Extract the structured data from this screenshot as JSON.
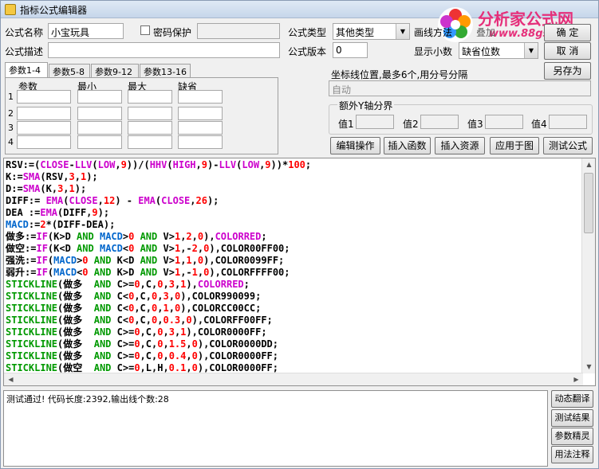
{
  "window": {
    "title": "指标公式编辑器"
  },
  "form": {
    "name_label": "公式名称",
    "name_value": "小宝玩具",
    "password_label": "密码保护",
    "type_label": "公式类型",
    "type_value": "其他类型",
    "draw_method_label": "画线方法",
    "desc_label": "公式描述",
    "desc_value": "",
    "version_label": "公式版本",
    "version_value": "0",
    "decimals_label": "显示小数",
    "decimals_value": "缺省位数",
    "ok_label": "确 定",
    "cancel_label": "取 消",
    "saveas_label": "另存为",
    "overlay_partial": "叠加"
  },
  "tabs": [
    "参数1-4",
    "参数5-8",
    "参数9-12",
    "参数13-16"
  ],
  "params": {
    "headers": [
      "参数",
      "最小",
      "最大",
      "缺省"
    ],
    "rows": [
      "1",
      "2",
      "3",
      "4"
    ]
  },
  "axis": {
    "label": "坐标线位置,最多6个,用分号分隔",
    "value": "自动",
    "group_title": "额外Y轴分界",
    "value_labels": [
      "值1",
      "值2",
      "值3",
      "值4"
    ]
  },
  "actions": [
    "编辑操作",
    "插入函数",
    "插入资源",
    "应用于图",
    "测试公式"
  ],
  "side_buttons": [
    "动态翻译",
    "测试结果",
    "参数精灵",
    "用法注释"
  ],
  "output_text": "测试通过! 代码长度:2392,输出线个数:28",
  "watermark": {
    "title": "分析家公式网",
    "url": "www.88gs.com"
  },
  "colors": {
    "keyword": "#009900",
    "function": "#cc00cc",
    "number": "#ff0000",
    "macd": "#0066cc",
    "title_bg": "#c6d6ea"
  },
  "code_lines": [
    [
      {
        "t": "RSV:=(",
        "c": "#000"
      },
      {
        "t": "CLOSE",
        "c": "#c0c"
      },
      {
        "t": "-",
        "c": "#000"
      },
      {
        "t": "LLV",
        "c": "#c0c"
      },
      {
        "t": "(",
        "c": "#000"
      },
      {
        "t": "LOW",
        "c": "#c0c"
      },
      {
        "t": ",",
        "c": "#000"
      },
      {
        "t": "9",
        "c": "#f00"
      },
      {
        "t": "))/(",
        "c": "#000"
      },
      {
        "t": "HHV",
        "c": "#c0c"
      },
      {
        "t": "(",
        "c": "#000"
      },
      {
        "t": "HIGH",
        "c": "#c0c"
      },
      {
        "t": ",",
        "c": "#000"
      },
      {
        "t": "9",
        "c": "#f00"
      },
      {
        "t": ")-",
        "c": "#000"
      },
      {
        "t": "LLV",
        "c": "#c0c"
      },
      {
        "t": "(",
        "c": "#000"
      },
      {
        "t": "LOW",
        "c": "#c0c"
      },
      {
        "t": ",",
        "c": "#000"
      },
      {
        "t": "9",
        "c": "#f00"
      },
      {
        "t": "))*",
        "c": "#000"
      },
      {
        "t": "100",
        "c": "#f00"
      },
      {
        "t": ";",
        "c": "#000"
      }
    ],
    [
      {
        "t": "K:=",
        "c": "#000"
      },
      {
        "t": "SMA",
        "c": "#c0c"
      },
      {
        "t": "(RSV,",
        "c": "#000"
      },
      {
        "t": "3",
        "c": "#f00"
      },
      {
        "t": ",",
        "c": "#000"
      },
      {
        "t": "1",
        "c": "#f00"
      },
      {
        "t": ");",
        "c": "#000"
      }
    ],
    [
      {
        "t": "D:=",
        "c": "#000"
      },
      {
        "t": "SMA",
        "c": "#c0c"
      },
      {
        "t": "(K,",
        "c": "#000"
      },
      {
        "t": "3",
        "c": "#f00"
      },
      {
        "t": ",",
        "c": "#000"
      },
      {
        "t": "1",
        "c": "#f00"
      },
      {
        "t": ");",
        "c": "#000"
      }
    ],
    [
      {
        "t": "DIFF:= ",
        "c": "#000"
      },
      {
        "t": "EMA",
        "c": "#c0c"
      },
      {
        "t": "(",
        "c": "#000"
      },
      {
        "t": "CLOSE",
        "c": "#c0c"
      },
      {
        "t": ",",
        "c": "#000"
      },
      {
        "t": "12",
        "c": "#f00"
      },
      {
        "t": ") - ",
        "c": "#000"
      },
      {
        "t": "EMA",
        "c": "#c0c"
      },
      {
        "t": "(",
        "c": "#000"
      },
      {
        "t": "CLOSE",
        "c": "#c0c"
      },
      {
        "t": ",",
        "c": "#000"
      },
      {
        "t": "26",
        "c": "#f00"
      },
      {
        "t": ");",
        "c": "#000"
      }
    ],
    [
      {
        "t": "DEA :=",
        "c": "#000"
      },
      {
        "t": "EMA",
        "c": "#c0c"
      },
      {
        "t": "(DIFF,",
        "c": "#000"
      },
      {
        "t": "9",
        "c": "#f00"
      },
      {
        "t": ");",
        "c": "#000"
      }
    ],
    [
      {
        "t": "MACD",
        "c": "#06c"
      },
      {
        "t": ":=",
        "c": "#000"
      },
      {
        "t": "2",
        "c": "#f00"
      },
      {
        "t": "*(DIFF-DEA);",
        "c": "#000"
      }
    ],
    [
      {
        "t": "做多",
        "c": "#000"
      },
      {
        "t": ":=",
        "c": "#000"
      },
      {
        "t": "IF",
        "c": "#c0c"
      },
      {
        "t": "(K>D ",
        "c": "#000"
      },
      {
        "t": "AND",
        "c": "#090"
      },
      {
        "t": " ",
        "c": "#000"
      },
      {
        "t": "MACD",
        "c": "#06c"
      },
      {
        "t": ">",
        "c": "#000"
      },
      {
        "t": "0",
        "c": "#f00"
      },
      {
        "t": " ",
        "c": "#000"
      },
      {
        "t": "AND",
        "c": "#090"
      },
      {
        "t": " V>",
        "c": "#000"
      },
      {
        "t": "1",
        "c": "#f00"
      },
      {
        "t": ",",
        "c": "#000"
      },
      {
        "t": "2",
        "c": "#f00"
      },
      {
        "t": ",",
        "c": "#000"
      },
      {
        "t": "0",
        "c": "#f00"
      },
      {
        "t": "),",
        "c": "#000"
      },
      {
        "t": "COLORRED",
        "c": "#c0c"
      },
      {
        "t": ";",
        "c": "#000"
      }
    ],
    [
      {
        "t": "做空",
        "c": "#000"
      },
      {
        "t": ":=",
        "c": "#000"
      },
      {
        "t": "IF",
        "c": "#c0c"
      },
      {
        "t": "(K<D ",
        "c": "#000"
      },
      {
        "t": "AND",
        "c": "#090"
      },
      {
        "t": " ",
        "c": "#000"
      },
      {
        "t": "MACD",
        "c": "#06c"
      },
      {
        "t": "<",
        "c": "#000"
      },
      {
        "t": "0",
        "c": "#f00"
      },
      {
        "t": " ",
        "c": "#000"
      },
      {
        "t": "AND",
        "c": "#090"
      },
      {
        "t": " V>",
        "c": "#000"
      },
      {
        "t": "1",
        "c": "#f00"
      },
      {
        "t": ",-",
        "c": "#000"
      },
      {
        "t": "2",
        "c": "#f00"
      },
      {
        "t": ",",
        "c": "#000"
      },
      {
        "t": "0",
        "c": "#f00"
      },
      {
        "t": "),COLOR00FF00;",
        "c": "#000"
      }
    ],
    [
      {
        "t": "强洗",
        "c": "#000"
      },
      {
        "t": ":=",
        "c": "#000"
      },
      {
        "t": "IF",
        "c": "#c0c"
      },
      {
        "t": "(",
        "c": "#000"
      },
      {
        "t": "MACD",
        "c": "#06c"
      },
      {
        "t": ">",
        "c": "#000"
      },
      {
        "t": "0",
        "c": "#f00"
      },
      {
        "t": " ",
        "c": "#000"
      },
      {
        "t": "AND",
        "c": "#090"
      },
      {
        "t": " K<D ",
        "c": "#000"
      },
      {
        "t": "AND",
        "c": "#090"
      },
      {
        "t": " V>",
        "c": "#000"
      },
      {
        "t": "1",
        "c": "#f00"
      },
      {
        "t": ",",
        "c": "#000"
      },
      {
        "t": "1",
        "c": "#f00"
      },
      {
        "t": ",",
        "c": "#000"
      },
      {
        "t": "0",
        "c": "#f00"
      },
      {
        "t": "),COLOR0099FF;",
        "c": "#000"
      }
    ],
    [
      {
        "t": "弱升",
        "c": "#000"
      },
      {
        "t": ":=",
        "c": "#000"
      },
      {
        "t": "IF",
        "c": "#c0c"
      },
      {
        "t": "(",
        "c": "#000"
      },
      {
        "t": "MACD",
        "c": "#06c"
      },
      {
        "t": "<",
        "c": "#000"
      },
      {
        "t": "0",
        "c": "#f00"
      },
      {
        "t": " ",
        "c": "#000"
      },
      {
        "t": "AND",
        "c": "#090"
      },
      {
        "t": " K>D ",
        "c": "#000"
      },
      {
        "t": "AND",
        "c": "#090"
      },
      {
        "t": " V>",
        "c": "#000"
      },
      {
        "t": "1",
        "c": "#f00"
      },
      {
        "t": ",-",
        "c": "#000"
      },
      {
        "t": "1",
        "c": "#f00"
      },
      {
        "t": ",",
        "c": "#000"
      },
      {
        "t": "0",
        "c": "#f00"
      },
      {
        "t": "),COLORFFFF00;",
        "c": "#000"
      }
    ],
    [
      {
        "t": "STICKLINE",
        "c": "#090"
      },
      {
        "t": "(做多  ",
        "c": "#000"
      },
      {
        "t": "AND",
        "c": "#090"
      },
      {
        "t": " C>=",
        "c": "#000"
      },
      {
        "t": "0",
        "c": "#f00"
      },
      {
        "t": ",C,",
        "c": "#000"
      },
      {
        "t": "0",
        "c": "#f00"
      },
      {
        "t": ",",
        "c": "#000"
      },
      {
        "t": "3",
        "c": "#f00"
      },
      {
        "t": ",",
        "c": "#000"
      },
      {
        "t": "1",
        "c": "#f00"
      },
      {
        "t": "),",
        "c": "#000"
      },
      {
        "t": "COLORRED",
        "c": "#c0c"
      },
      {
        "t": ";",
        "c": "#000"
      }
    ],
    [
      {
        "t": "STICKLINE",
        "c": "#090"
      },
      {
        "t": "(做多  ",
        "c": "#000"
      },
      {
        "t": "AND",
        "c": "#090"
      },
      {
        "t": " C<",
        "c": "#000"
      },
      {
        "t": "0",
        "c": "#f00"
      },
      {
        "t": ",C,",
        "c": "#000"
      },
      {
        "t": "0",
        "c": "#f00"
      },
      {
        "t": ",",
        "c": "#000"
      },
      {
        "t": "3",
        "c": "#f00"
      },
      {
        "t": ",",
        "c": "#000"
      },
      {
        "t": "0",
        "c": "#f00"
      },
      {
        "t": "),COLOR990099;",
        "c": "#000"
      }
    ],
    [
      {
        "t": "STICKLINE",
        "c": "#090"
      },
      {
        "t": "(做多  ",
        "c": "#000"
      },
      {
        "t": "AND",
        "c": "#090"
      },
      {
        "t": " C<",
        "c": "#000"
      },
      {
        "t": "0",
        "c": "#f00"
      },
      {
        "t": ",C,",
        "c": "#000"
      },
      {
        "t": "0",
        "c": "#f00"
      },
      {
        "t": ",",
        "c": "#000"
      },
      {
        "t": "1",
        "c": "#f00"
      },
      {
        "t": ",",
        "c": "#000"
      },
      {
        "t": "0",
        "c": "#f00"
      },
      {
        "t": "),COLORCC00CC;",
        "c": "#000"
      }
    ],
    [
      {
        "t": "STICKLINE",
        "c": "#090"
      },
      {
        "t": "(做多  ",
        "c": "#000"
      },
      {
        "t": "AND",
        "c": "#090"
      },
      {
        "t": " C<",
        "c": "#000"
      },
      {
        "t": "0",
        "c": "#f00"
      },
      {
        "t": ",C,",
        "c": "#000"
      },
      {
        "t": "0",
        "c": "#f00"
      },
      {
        "t": ",",
        "c": "#000"
      },
      {
        "t": "0.3",
        "c": "#f00"
      },
      {
        "t": ",",
        "c": "#000"
      },
      {
        "t": "0",
        "c": "#f00"
      },
      {
        "t": "),COLORFF00FF;",
        "c": "#000"
      }
    ],
    [
      {
        "t": "STICKLINE",
        "c": "#090"
      },
      {
        "t": "(做多  ",
        "c": "#000"
      },
      {
        "t": "AND",
        "c": "#090"
      },
      {
        "t": " C>=",
        "c": "#000"
      },
      {
        "t": "0",
        "c": "#f00"
      },
      {
        "t": ",C,",
        "c": "#000"
      },
      {
        "t": "0",
        "c": "#f00"
      },
      {
        "t": ",",
        "c": "#000"
      },
      {
        "t": "3",
        "c": "#f00"
      },
      {
        "t": ",",
        "c": "#000"
      },
      {
        "t": "1",
        "c": "#f00"
      },
      {
        "t": "),COLOR0000FF;",
        "c": "#000"
      }
    ],
    [
      {
        "t": "STICKLINE",
        "c": "#090"
      },
      {
        "t": "(做多  ",
        "c": "#000"
      },
      {
        "t": "AND",
        "c": "#090"
      },
      {
        "t": " C>=",
        "c": "#000"
      },
      {
        "t": "0",
        "c": "#f00"
      },
      {
        "t": ",C,",
        "c": "#000"
      },
      {
        "t": "0",
        "c": "#f00"
      },
      {
        "t": ",",
        "c": "#000"
      },
      {
        "t": "1.5",
        "c": "#f00"
      },
      {
        "t": ",",
        "c": "#000"
      },
      {
        "t": "0",
        "c": "#f00"
      },
      {
        "t": "),COLOR0000DD;",
        "c": "#000"
      }
    ],
    [
      {
        "t": "STICKLINE",
        "c": "#090"
      },
      {
        "t": "(做多  ",
        "c": "#000"
      },
      {
        "t": "AND",
        "c": "#090"
      },
      {
        "t": " C>=",
        "c": "#000"
      },
      {
        "t": "0",
        "c": "#f00"
      },
      {
        "t": ",C,",
        "c": "#000"
      },
      {
        "t": "0",
        "c": "#f00"
      },
      {
        "t": ",",
        "c": "#000"
      },
      {
        "t": "0.4",
        "c": "#f00"
      },
      {
        "t": ",",
        "c": "#000"
      },
      {
        "t": "0",
        "c": "#f00"
      },
      {
        "t": "),COLOR0000FF;",
        "c": "#000"
      }
    ],
    [
      {
        "t": "STICKLINE",
        "c": "#090"
      },
      {
        "t": "(做空  ",
        "c": "#000"
      },
      {
        "t": "AND",
        "c": "#090"
      },
      {
        "t": " C>=",
        "c": "#000"
      },
      {
        "t": "0",
        "c": "#f00"
      },
      {
        "t": ",L,H,",
        "c": "#000"
      },
      {
        "t": "0.1",
        "c": "#f00"
      },
      {
        "t": ",",
        "c": "#000"
      },
      {
        "t": "0",
        "c": "#f00"
      },
      {
        "t": "),COLOR0000FF;",
        "c": "#000"
      }
    ]
  ]
}
